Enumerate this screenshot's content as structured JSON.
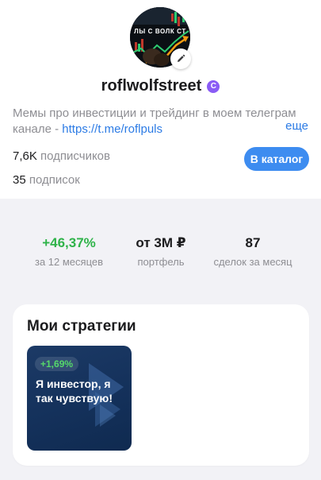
{
  "profile": {
    "avatar_text": "ЛЫ С ВОЛК СТ",
    "username": "roflwolfstreet",
    "premium_badge": "C",
    "bio_text": "Мемы про инвестиции и трейдинг в моем телеграм канале - ",
    "bio_link": "https://t.me/roflpuls",
    "more_label": "еще",
    "subscribers_count": "7,6K",
    "subscribers_label": "подписчиков",
    "subscriptions_count": "35",
    "subscriptions_label": "подписок",
    "catalog_button": "В каталог"
  },
  "stats": [
    {
      "value": "+46,37%",
      "label": "за 12 месяцев"
    },
    {
      "value": "от 3М ₽",
      "label": "портфель"
    },
    {
      "value": "87",
      "label": "сделок за месяц"
    }
  ],
  "strategies": {
    "title": "Мои стратегии",
    "items": [
      {
        "return": "+1,69%",
        "name": "Я инвестор, я так чувствую!"
      }
    ]
  },
  "colors": {
    "accent": "#3d8cf0",
    "positive": "#2fb34a",
    "premium": "#8a5cf5",
    "tile_bg": "#14315b"
  }
}
